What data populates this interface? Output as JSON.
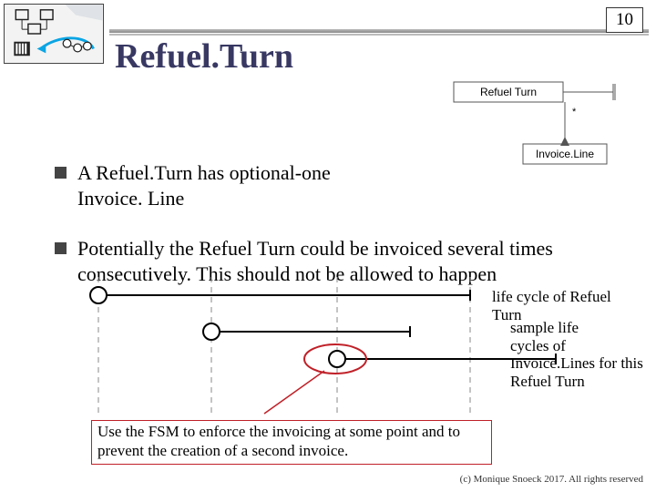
{
  "slide_number": "10",
  "title": "Refuel.Turn",
  "bullet1": "A Refuel.Turn has optional-one Invoice. Line",
  "bullet2": "Potentially the Refuel Turn could be invoiced several times consecutively. This should not be allowed to happen",
  "dia": {
    "refuel_label": "Refuel Turn",
    "invoice_label": "Invoice.Line"
  },
  "life_caption1": "life cycle of Refuel Turn",
  "life_caption2": "sample life\n cycles of\nInvoice.Lines for this\nRefuel Turn",
  "tip": "  Use the FSM to enforce the invoicing at some point and to prevent the creation of a second invoice.",
  "copyright": "(c) Monique Snoeck 2017. All rights reserved"
}
